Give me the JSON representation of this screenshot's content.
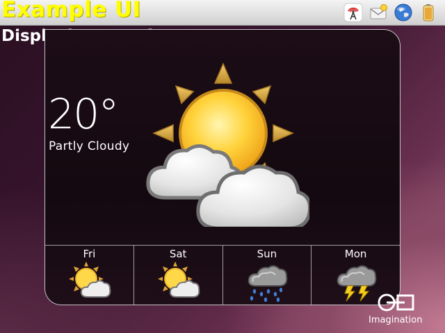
{
  "app": {
    "title": "Example UI"
  },
  "header": {
    "subtitle": "Displaying Interface",
    "tray_icons": [
      "antenna-icon",
      "mail-icon",
      "globe-icon",
      "battery-icon"
    ]
  },
  "weather": {
    "temperature": "20°",
    "condition": "Partly Cloudy",
    "current_icon": "partly-cloudy-icon",
    "forecast": [
      {
        "day": "Fri",
        "icon": "partly-cloudy-icon"
      },
      {
        "day": "Sat",
        "icon": "partly-cloudy-icon"
      },
      {
        "day": "Sun",
        "icon": "rain-icon"
      },
      {
        "day": "Mon",
        "icon": "thunderstorm-icon"
      }
    ]
  },
  "brand": {
    "name": "Imagination",
    "logo_icon": "imagination-logo-icon"
  },
  "colors": {
    "title": "#ffff00",
    "sun": "#f7c62a",
    "sun_ray": "#d9a23a"
  }
}
